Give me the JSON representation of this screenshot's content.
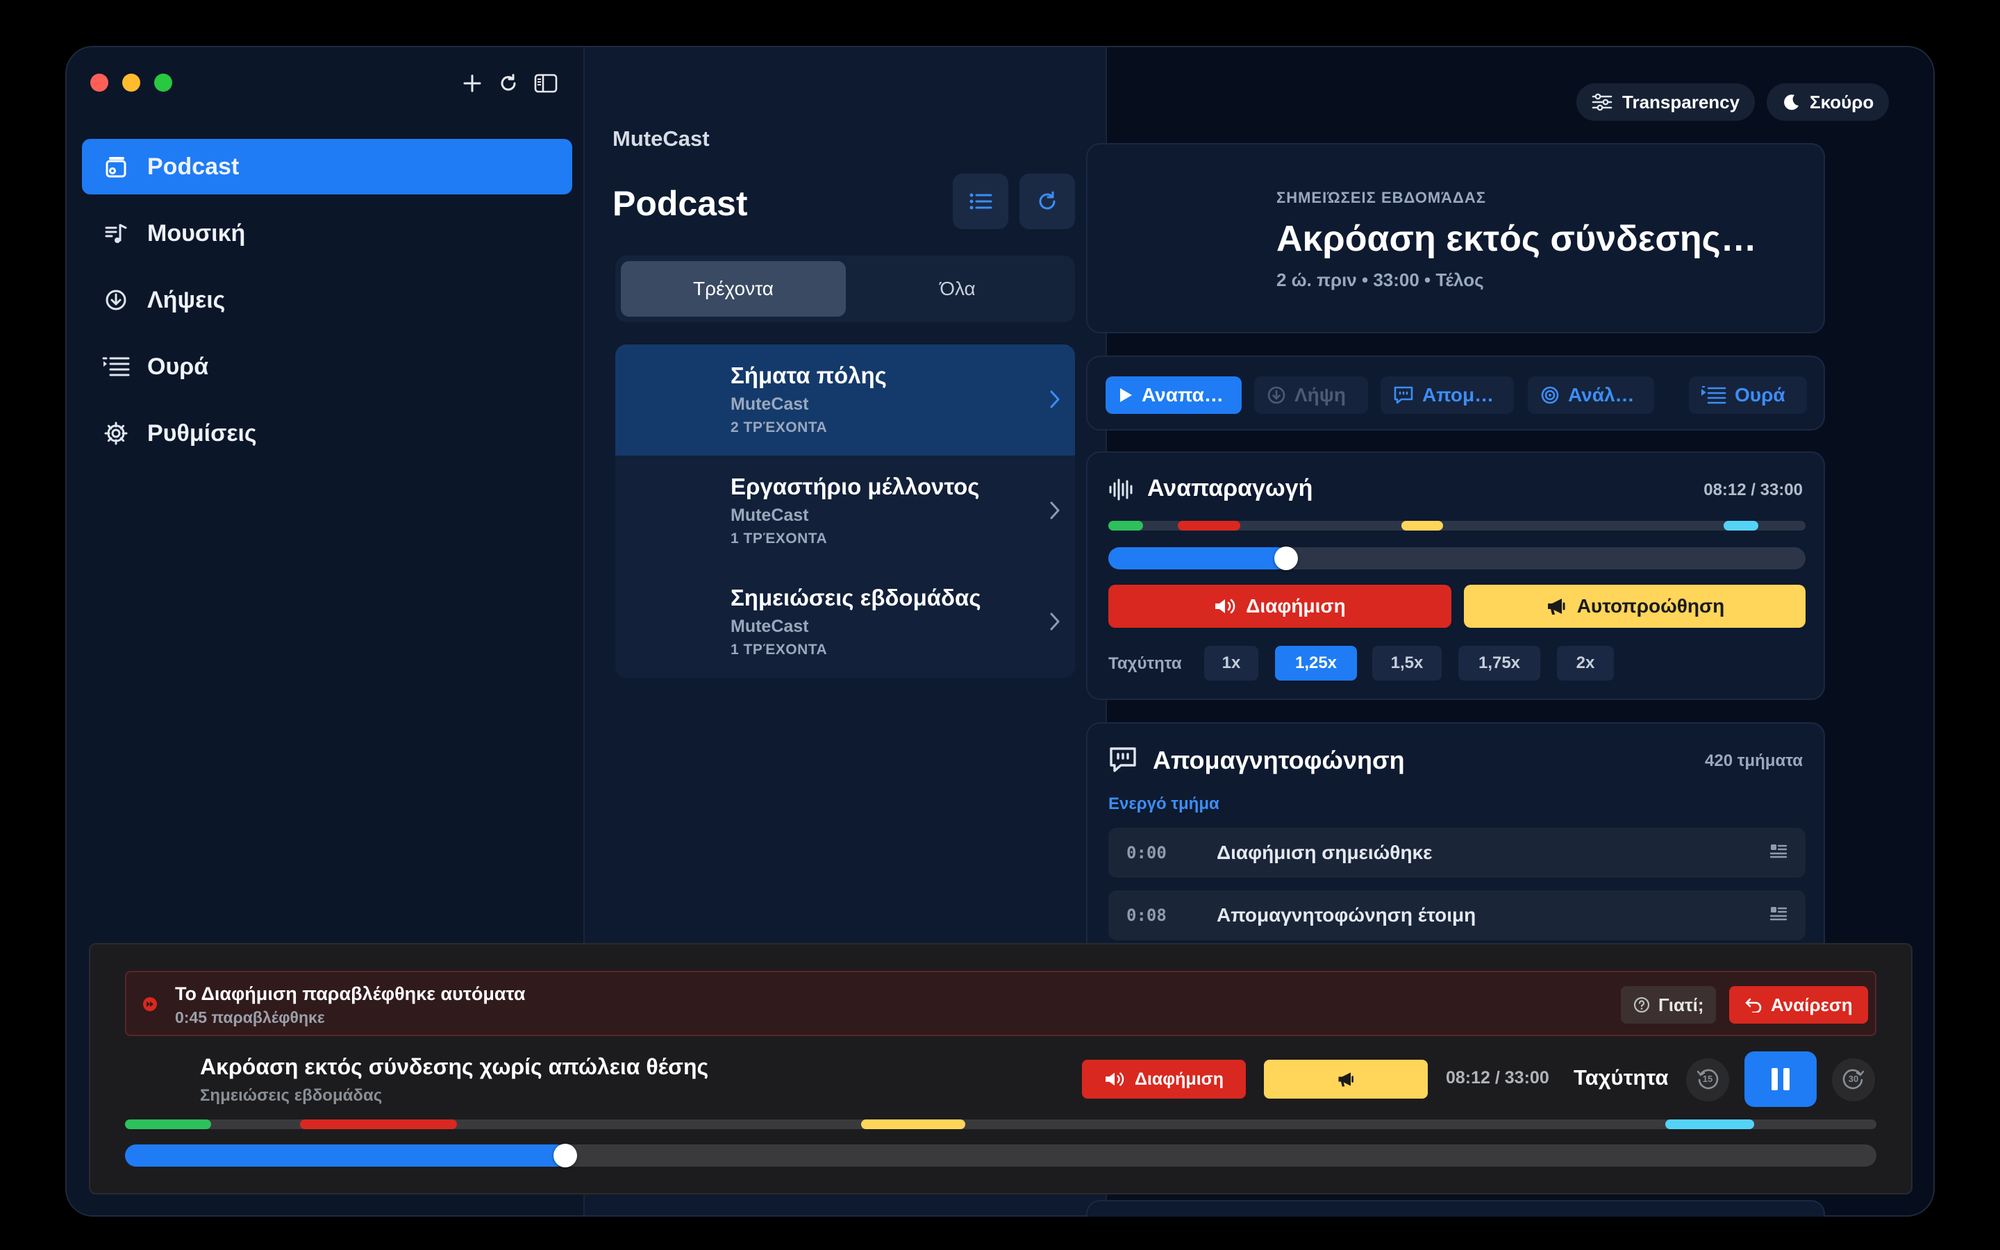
{
  "colors": {
    "accent": "#1f7cf5",
    "ad": "#d9281f",
    "selfpromo": "#ffd55a",
    "green": "#2ec05c",
    "cyan": "#55d3f7"
  },
  "sidebar": {
    "items": [
      {
        "label": "Podcast",
        "icon": "podcast-icon",
        "active": true
      },
      {
        "label": "Μουσική",
        "icon": "music-icon"
      },
      {
        "label": "Λήψεις",
        "icon": "download-icon"
      },
      {
        "label": "Ουρά",
        "icon": "queue-icon"
      },
      {
        "label": "Ρυθμίσεις",
        "icon": "gear-icon"
      }
    ]
  },
  "middle": {
    "app_name": "MuteCast",
    "title": "Podcast",
    "tabs": [
      {
        "label": "Τρέχοντα",
        "active": true
      },
      {
        "label": "Όλα"
      }
    ],
    "podcasts": [
      {
        "title": "Σήματα πόλης",
        "author": "MuteCast",
        "count": "2 ΤΡΈΧΟΝΤΑ",
        "selected": true
      },
      {
        "title": "Εργαστήριο μέλλοντος",
        "author": "MuteCast",
        "count": "1 ΤΡΈΧΟΝΤΑ"
      },
      {
        "title": "Σημειώσεις εβδομάδας",
        "author": "MuteCast",
        "count": "1 ΤΡΈΧΟΝΤΑ"
      }
    ]
  },
  "right": {
    "chips": {
      "transparency": "Transparency",
      "theme": "Σκούρο"
    },
    "episode": {
      "kicker": "ΣΗΜΕΙΏΣΕΙΣ ΕΒΔΟΜΆΔΑΣ",
      "title": "Ακρόαση εκτός σύνδεσης…",
      "meta": "2 ώ. πριν • 33:00 • Τέλος"
    },
    "actions": {
      "play": "Αναπα…",
      "download": "Λήψη",
      "transcript": "Απομ…",
      "analyze": "Ανάλ…",
      "queue": "Ουρά"
    },
    "playback": {
      "title": "Αναπαραγωγή",
      "time": "08:12 / 33:00",
      "progress": 0.2485,
      "ad_label": "Διαφήμιση",
      "promo_label": "Αυτοπροώθηση",
      "speed_label": "Ταχύτητα",
      "speeds": [
        "1x",
        "1,25x",
        "1,5x",
        "1,75x",
        "2x"
      ],
      "active_speed": "1,25x"
    },
    "transcript": {
      "title": "Απομαγνητοφώνηση",
      "count": "420 τμήματα",
      "active_label": "Ενεργό τμήμα",
      "rows": [
        {
          "time": "0:00",
          "text": "Διαφήμιση σημειώθηκε"
        },
        {
          "time": "0:08",
          "text": "Απομαγνητοφώνηση έτοιμη"
        }
      ]
    }
  },
  "player": {
    "alert": {
      "title": "Το Διαφήμιση παραβλέφθηκε αυτόματα",
      "subtitle": "0:45 παραβλέφθηκε",
      "why": "Γιατί;",
      "undo": "Αναίρεση"
    },
    "title": "Ακρόαση εκτός σύνδεσης χωρίς απώλεια θέσης",
    "subtitle": "Σημειώσεις εβδομάδας",
    "ad_label": "Διαφήμιση",
    "time": "08:12 / 33:00",
    "speed_label": "Ταχύτητα",
    "skip_back": "15",
    "skip_fwd": "30",
    "progress": 0.2485
  }
}
